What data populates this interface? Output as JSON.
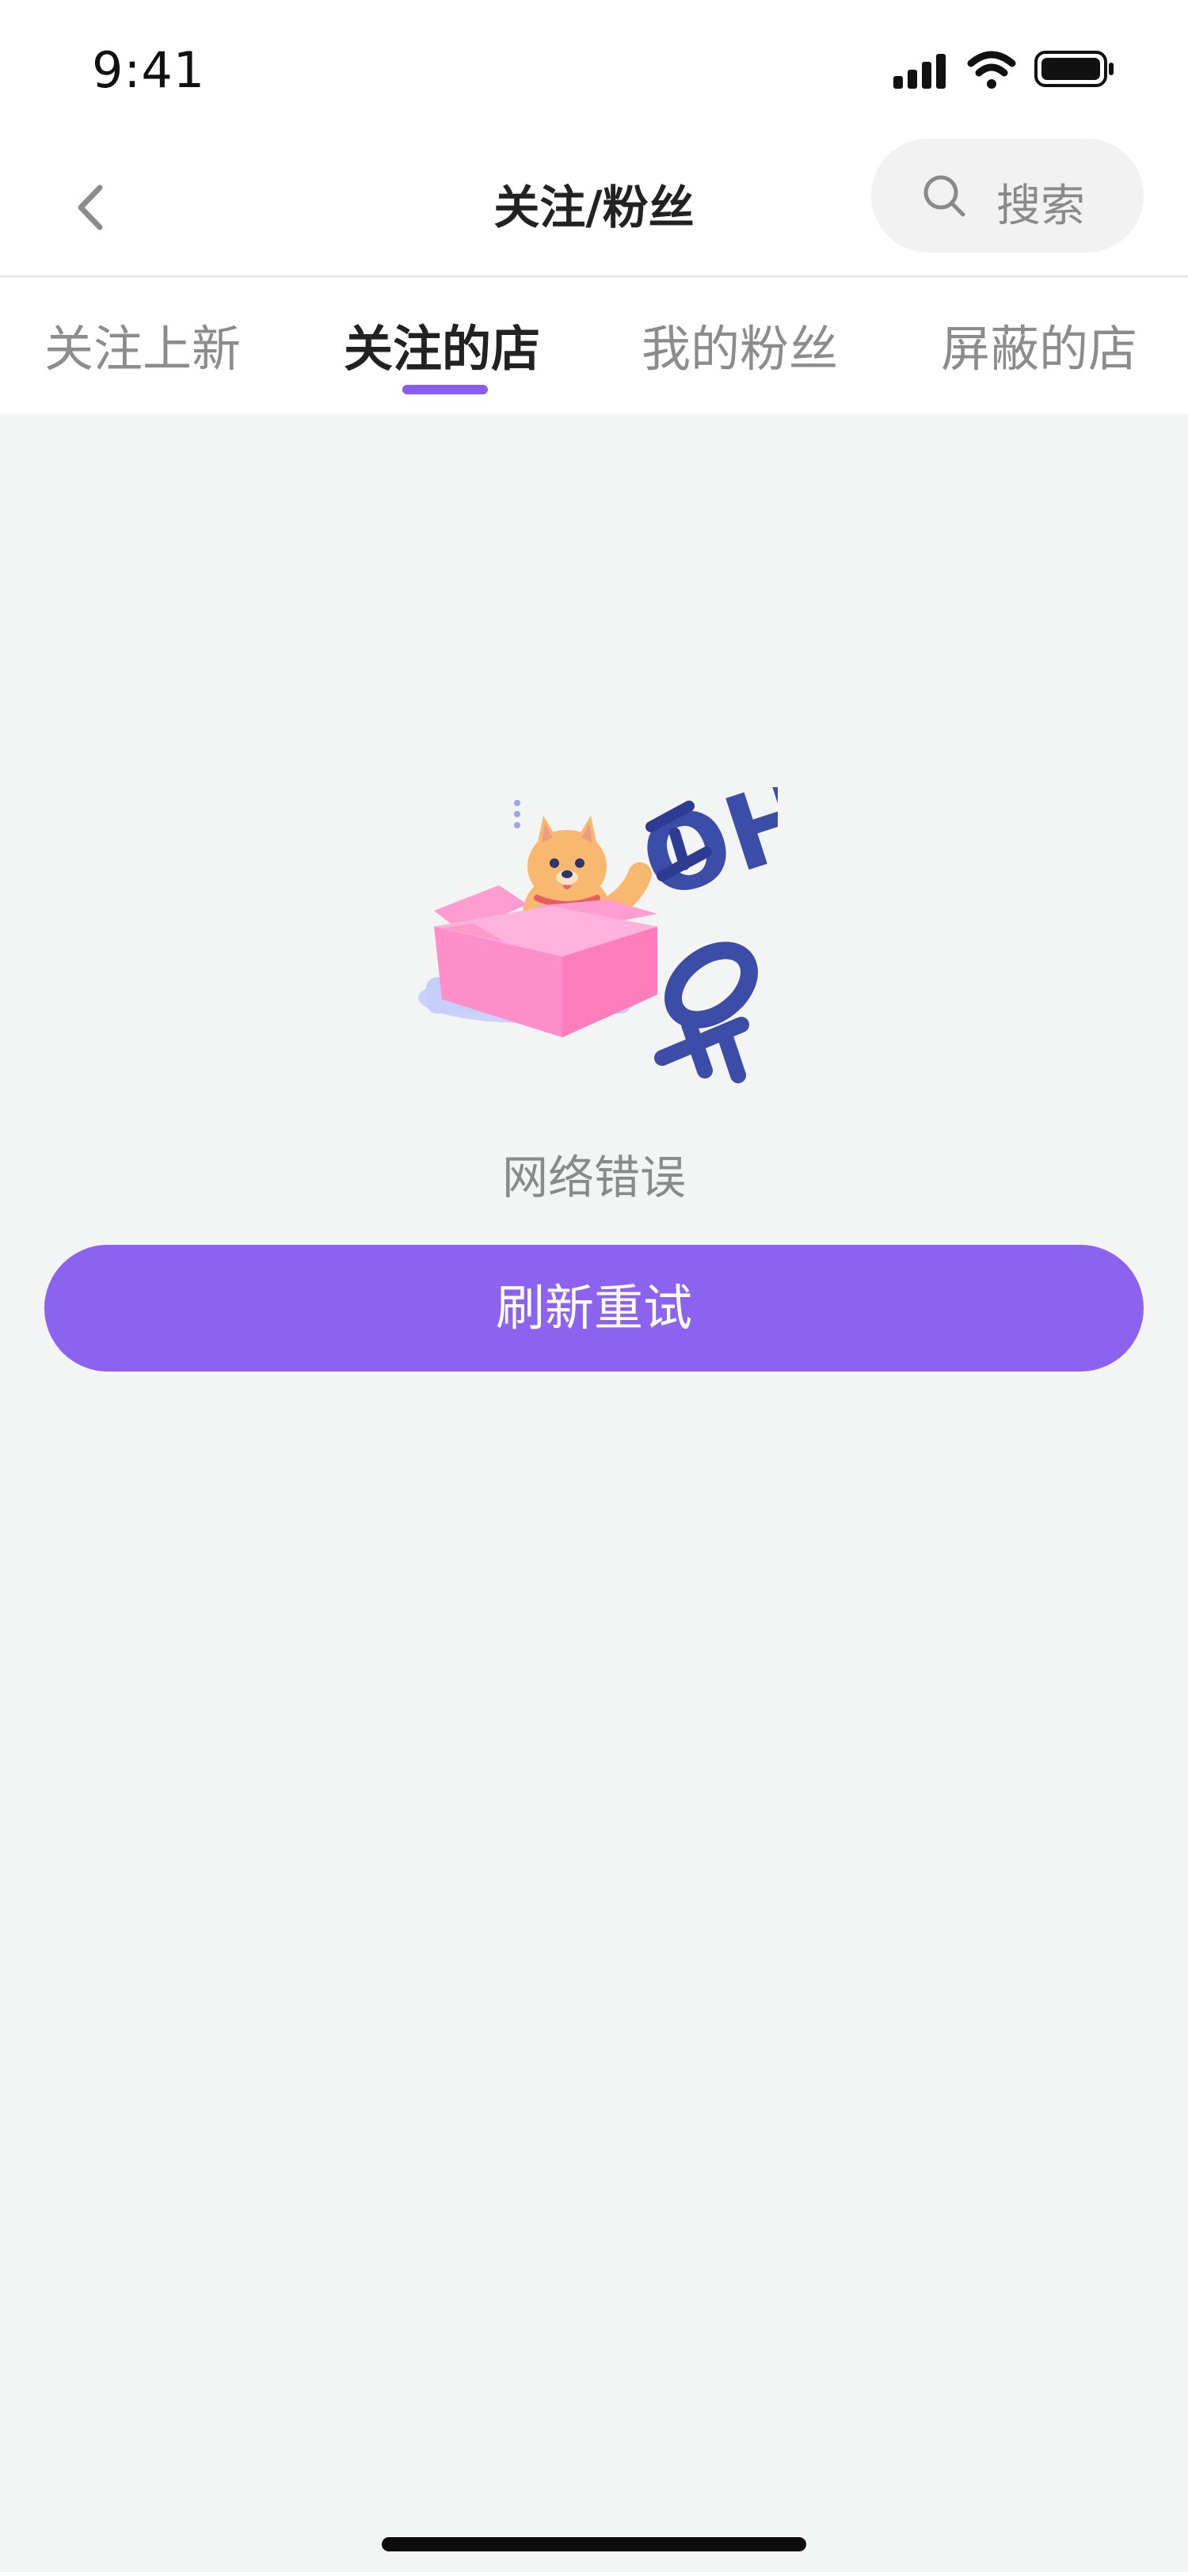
{
  "status_bar": {
    "time": "9:41"
  },
  "nav": {
    "title": "关注/粉丝",
    "search_label": "搜索"
  },
  "tabs": [
    {
      "label": "关注上新",
      "active": false
    },
    {
      "label": "关注的店",
      "active": true
    },
    {
      "label": "我的粉丝",
      "active": false
    },
    {
      "label": "屏蔽的店",
      "active": false
    }
  ],
  "error_state": {
    "message": "网络错误",
    "retry_label": "刷新重试",
    "illustration_letters": "OH"
  },
  "colors": {
    "accent": "#8b63ef",
    "background": "#f3f4f4",
    "text_primary": "#222222",
    "text_secondary": "#8a8a8a"
  },
  "icons": [
    "signal-icon",
    "wifi-icon",
    "battery-icon",
    "back-arrow-icon",
    "search-icon"
  ]
}
